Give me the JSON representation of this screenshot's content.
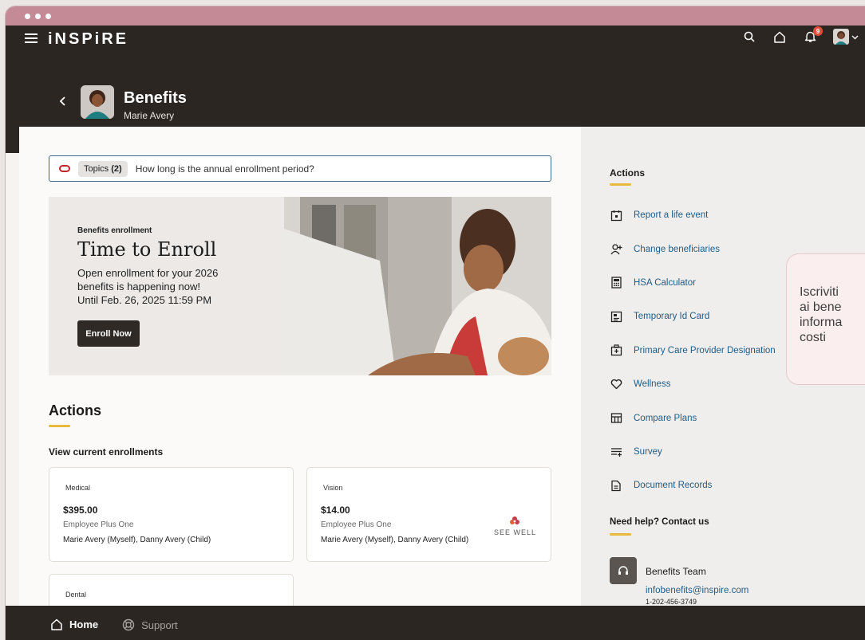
{
  "app": {
    "logo": "iNSPiRE"
  },
  "header": {
    "title": "Benefits",
    "subtitle": "Marie Avery",
    "notification_count": "9"
  },
  "search": {
    "chip_label": "Topics",
    "chip_count": "(2)",
    "query": "How long is the annual enrollment period?"
  },
  "hero": {
    "kicker": "Benefits enrollment",
    "title": "Time to Enroll",
    "line1": "Open enrollment for your 2026",
    "line2": "benefits is happening now!",
    "line3": "Until Feb. 26, 2025 11:59 PM",
    "button": "Enroll Now"
  },
  "main": {
    "actions_heading": "Actions",
    "current_enrollments": "View current enrollments",
    "cards": [
      {
        "type": "Medical",
        "price": "$395.00",
        "plan": "Employee Plus One",
        "people": "Marie Avery (Myself), Danny Avery (Child)"
      },
      {
        "type": "Vision",
        "price": "$14.00",
        "plan": "Employee Plus One",
        "people": "Marie Avery (Myself), Danny Avery (Child)",
        "logo_text": "SEE WELL"
      },
      {
        "type": "Dental"
      }
    ]
  },
  "sidebar": {
    "title": "Actions",
    "items": [
      {
        "label": "Report a life event",
        "icon": "calendar-event-icon"
      },
      {
        "label": "Change beneficiaries",
        "icon": "person-add-icon"
      },
      {
        "label": "HSA Calculator",
        "icon": "calculator-icon"
      },
      {
        "label": "Temporary Id Card",
        "icon": "id-card-icon"
      },
      {
        "label": "Primary Care Provider Designation",
        "icon": "medical-building-icon"
      },
      {
        "label": "Wellness",
        "icon": "heart-icon"
      },
      {
        "label": "Compare Plans",
        "icon": "compare-table-icon"
      },
      {
        "label": "Survey",
        "icon": "survey-list-icon"
      },
      {
        "label": "Document Records",
        "icon": "document-icon"
      }
    ],
    "help_title": "Need help? Contact us",
    "team": {
      "name": "Benefits Team",
      "email": "infobenefits@inspire.com",
      "phone": "1-202-456-3749"
    }
  },
  "bubble": {
    "line1": "Iscriviti",
    "line2": "ai bene",
    "line3": "informa",
    "line4": "costi"
  },
  "bottom_nav": {
    "home": "Home",
    "support": "Support"
  },
  "colors": {
    "brand_dark": "#2b2622",
    "titlebar": "#c48b96",
    "link": "#1f5c86",
    "accent_gold": "#e8b93b",
    "focus_border": "#3b6a8a",
    "badge": "#e04e3a"
  }
}
